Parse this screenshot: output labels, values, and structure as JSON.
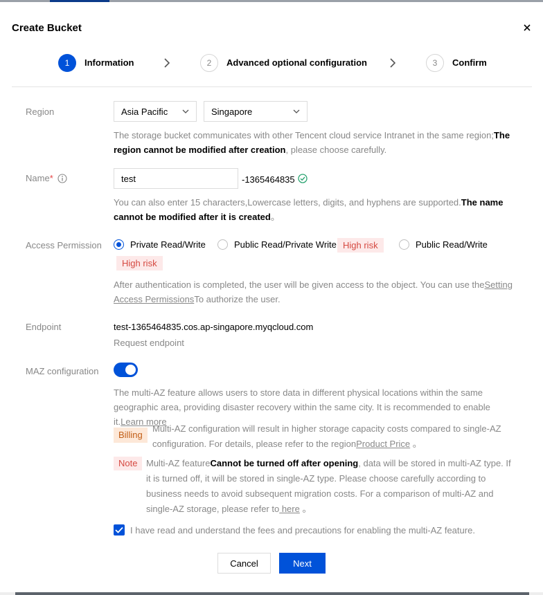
{
  "dialog": {
    "title": "Create Bucket"
  },
  "steps": [
    {
      "number": "1",
      "label": "Information"
    },
    {
      "number": "2",
      "label": "Advanced optional configuration"
    },
    {
      "number": "3",
      "label": "Confirm"
    }
  ],
  "region": {
    "label": "Region",
    "area": "Asia Pacific",
    "city": "Singapore",
    "help_pre": "The storage bucket communicates with other Tencent cloud service Intranet in the same region;",
    "help_bold": "The region cannot be modified after creation",
    "help_post": ", please choose carefully."
  },
  "name": {
    "label": "Name",
    "required_mark": "*",
    "value": "test",
    "suffix": "-1365464835",
    "help_pre": "You can also enter 15 characters,Lowercase letters, digits, and hyphens are supported.",
    "help_bold": "The name cannot be modified after it is created",
    "help_post": "。"
  },
  "access": {
    "label": "Access Permission",
    "options": [
      {
        "label": "Private Read/Write",
        "selected": true
      },
      {
        "label": "Public Read/Private Write",
        "selected": false,
        "tag": "High risk"
      },
      {
        "label": "Public Read/Write",
        "selected": false,
        "tag": "High risk"
      }
    ],
    "help_pre": "After authentication is completed, the user will be given access to the object. You can use the",
    "help_link": "Setting Access Permissions",
    "help_post": "To authorize the user."
  },
  "endpoint": {
    "label": "Endpoint",
    "value": "test-1365464835.cos.ap-singapore.myqcloud.com",
    "sub": "Request endpoint"
  },
  "maz": {
    "label": "MAZ configuration",
    "enabled": true,
    "desc": "The multi-AZ feature allows users to store data in different physical locations within the same geographic area, providing disaster recovery within the same city. It is recommended to enable it.",
    "learn_more": "Learn more",
    "billing_tag": "Billing",
    "billing_text": "Multi-AZ configuration will result in higher storage capacity costs compared to single-AZ configuration. For details, please refer to the region",
    "billing_link": "Product Price",
    "billing_post": " 。",
    "note_tag": "Note",
    "note_pre": "Multi-AZ feature",
    "note_bold": "Cannot be turned off after opening",
    "note_text": ", data will be stored in multi-AZ type. If it is turned off, it will be stored in single-AZ type. Please choose carefully according to business needs to avoid subsequent migration costs. For a comparison of multi-AZ and single-AZ storage, please refer to",
    "note_link": " here",
    "note_post": " 。",
    "ack_label": "I have read and understand the fees and precautions for enabling the multi-AZ feature.",
    "ack_checked": true
  },
  "buttons": {
    "cancel": "Cancel",
    "next": "Next"
  },
  "colors": {
    "primary": "#0052d9",
    "risk": "#d54941",
    "billing": "#c15d16"
  }
}
